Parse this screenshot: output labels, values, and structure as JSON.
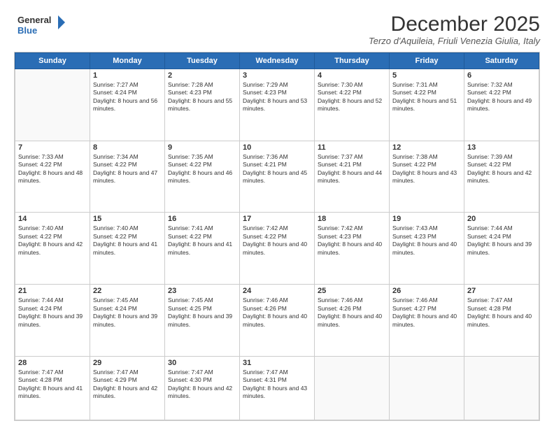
{
  "logo": {
    "line1": "General",
    "line2": "Blue"
  },
  "title": "December 2025",
  "subtitle": "Terzo d'Aquileia, Friuli Venezia Giulia, Italy",
  "headers": [
    "Sunday",
    "Monday",
    "Tuesday",
    "Wednesday",
    "Thursday",
    "Friday",
    "Saturday"
  ],
  "weeks": [
    [
      {
        "day": "",
        "sunrise": "",
        "sunset": "",
        "daylight": ""
      },
      {
        "day": "1",
        "sunrise": "Sunrise: 7:27 AM",
        "sunset": "Sunset: 4:24 PM",
        "daylight": "Daylight: 8 hours and 56 minutes."
      },
      {
        "day": "2",
        "sunrise": "Sunrise: 7:28 AM",
        "sunset": "Sunset: 4:23 PM",
        "daylight": "Daylight: 8 hours and 55 minutes."
      },
      {
        "day": "3",
        "sunrise": "Sunrise: 7:29 AM",
        "sunset": "Sunset: 4:23 PM",
        "daylight": "Daylight: 8 hours and 53 minutes."
      },
      {
        "day": "4",
        "sunrise": "Sunrise: 7:30 AM",
        "sunset": "Sunset: 4:22 PM",
        "daylight": "Daylight: 8 hours and 52 minutes."
      },
      {
        "day": "5",
        "sunrise": "Sunrise: 7:31 AM",
        "sunset": "Sunset: 4:22 PM",
        "daylight": "Daylight: 8 hours and 51 minutes."
      },
      {
        "day": "6",
        "sunrise": "Sunrise: 7:32 AM",
        "sunset": "Sunset: 4:22 PM",
        "daylight": "Daylight: 8 hours and 49 minutes."
      }
    ],
    [
      {
        "day": "7",
        "sunrise": "Sunrise: 7:33 AM",
        "sunset": "Sunset: 4:22 PM",
        "daylight": "Daylight: 8 hours and 48 minutes."
      },
      {
        "day": "8",
        "sunrise": "Sunrise: 7:34 AM",
        "sunset": "Sunset: 4:22 PM",
        "daylight": "Daylight: 8 hours and 47 minutes."
      },
      {
        "day": "9",
        "sunrise": "Sunrise: 7:35 AM",
        "sunset": "Sunset: 4:22 PM",
        "daylight": "Daylight: 8 hours and 46 minutes."
      },
      {
        "day": "10",
        "sunrise": "Sunrise: 7:36 AM",
        "sunset": "Sunset: 4:21 PM",
        "daylight": "Daylight: 8 hours and 45 minutes."
      },
      {
        "day": "11",
        "sunrise": "Sunrise: 7:37 AM",
        "sunset": "Sunset: 4:21 PM",
        "daylight": "Daylight: 8 hours and 44 minutes."
      },
      {
        "day": "12",
        "sunrise": "Sunrise: 7:38 AM",
        "sunset": "Sunset: 4:22 PM",
        "daylight": "Daylight: 8 hours and 43 minutes."
      },
      {
        "day": "13",
        "sunrise": "Sunrise: 7:39 AM",
        "sunset": "Sunset: 4:22 PM",
        "daylight": "Daylight: 8 hours and 42 minutes."
      }
    ],
    [
      {
        "day": "14",
        "sunrise": "Sunrise: 7:40 AM",
        "sunset": "Sunset: 4:22 PM",
        "daylight": "Daylight: 8 hours and 42 minutes."
      },
      {
        "day": "15",
        "sunrise": "Sunrise: 7:40 AM",
        "sunset": "Sunset: 4:22 PM",
        "daylight": "Daylight: 8 hours and 41 minutes."
      },
      {
        "day": "16",
        "sunrise": "Sunrise: 7:41 AM",
        "sunset": "Sunset: 4:22 PM",
        "daylight": "Daylight: 8 hours and 41 minutes."
      },
      {
        "day": "17",
        "sunrise": "Sunrise: 7:42 AM",
        "sunset": "Sunset: 4:22 PM",
        "daylight": "Daylight: 8 hours and 40 minutes."
      },
      {
        "day": "18",
        "sunrise": "Sunrise: 7:42 AM",
        "sunset": "Sunset: 4:23 PM",
        "daylight": "Daylight: 8 hours and 40 minutes."
      },
      {
        "day": "19",
        "sunrise": "Sunrise: 7:43 AM",
        "sunset": "Sunset: 4:23 PM",
        "daylight": "Daylight: 8 hours and 40 minutes."
      },
      {
        "day": "20",
        "sunrise": "Sunrise: 7:44 AM",
        "sunset": "Sunset: 4:24 PM",
        "daylight": "Daylight: 8 hours and 39 minutes."
      }
    ],
    [
      {
        "day": "21",
        "sunrise": "Sunrise: 7:44 AM",
        "sunset": "Sunset: 4:24 PM",
        "daylight": "Daylight: 8 hours and 39 minutes."
      },
      {
        "day": "22",
        "sunrise": "Sunrise: 7:45 AM",
        "sunset": "Sunset: 4:24 PM",
        "daylight": "Daylight: 8 hours and 39 minutes."
      },
      {
        "day": "23",
        "sunrise": "Sunrise: 7:45 AM",
        "sunset": "Sunset: 4:25 PM",
        "daylight": "Daylight: 8 hours and 39 minutes."
      },
      {
        "day": "24",
        "sunrise": "Sunrise: 7:46 AM",
        "sunset": "Sunset: 4:26 PM",
        "daylight": "Daylight: 8 hours and 40 minutes."
      },
      {
        "day": "25",
        "sunrise": "Sunrise: 7:46 AM",
        "sunset": "Sunset: 4:26 PM",
        "daylight": "Daylight: 8 hours and 40 minutes."
      },
      {
        "day": "26",
        "sunrise": "Sunrise: 7:46 AM",
        "sunset": "Sunset: 4:27 PM",
        "daylight": "Daylight: 8 hours and 40 minutes."
      },
      {
        "day": "27",
        "sunrise": "Sunrise: 7:47 AM",
        "sunset": "Sunset: 4:28 PM",
        "daylight": "Daylight: 8 hours and 40 minutes."
      }
    ],
    [
      {
        "day": "28",
        "sunrise": "Sunrise: 7:47 AM",
        "sunset": "Sunset: 4:28 PM",
        "daylight": "Daylight: 8 hours and 41 minutes."
      },
      {
        "day": "29",
        "sunrise": "Sunrise: 7:47 AM",
        "sunset": "Sunset: 4:29 PM",
        "daylight": "Daylight: 8 hours and 42 minutes."
      },
      {
        "day": "30",
        "sunrise": "Sunrise: 7:47 AM",
        "sunset": "Sunset: 4:30 PM",
        "daylight": "Daylight: 8 hours and 42 minutes."
      },
      {
        "day": "31",
        "sunrise": "Sunrise: 7:47 AM",
        "sunset": "Sunset: 4:31 PM",
        "daylight": "Daylight: 8 hours and 43 minutes."
      },
      {
        "day": "",
        "sunrise": "",
        "sunset": "",
        "daylight": ""
      },
      {
        "day": "",
        "sunrise": "",
        "sunset": "",
        "daylight": ""
      },
      {
        "day": "",
        "sunrise": "",
        "sunset": "",
        "daylight": ""
      }
    ]
  ]
}
